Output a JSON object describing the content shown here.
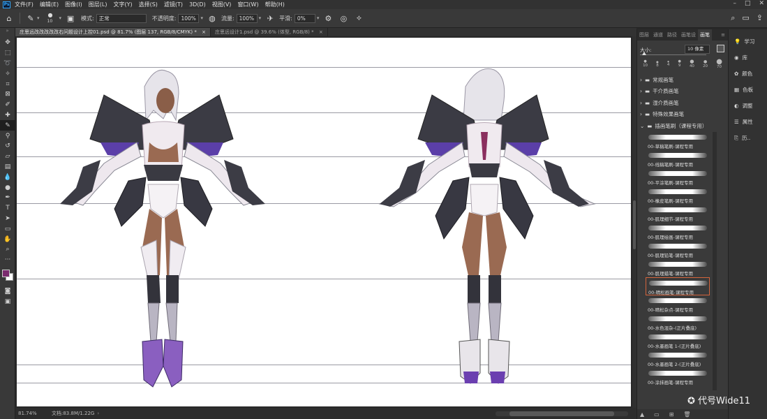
{
  "menubar": {
    "items": [
      "文件(F)",
      "编辑(E)",
      "图像(I)",
      "图层(L)",
      "文字(Y)",
      "选择(S)",
      "滤镜(T)",
      "3D(D)",
      "视图(V)",
      "窗口(W)",
      "帮助(H)"
    ]
  },
  "options": {
    "brush_size": "10",
    "mode_label": "模式:",
    "mode_value": "正常",
    "opacity_label": "不透明度:",
    "opacity_value": "100%",
    "flow_label": "流量:",
    "flow_value": "100%",
    "smooth_label": "平滑:",
    "smooth_value": "0%"
  },
  "tabs": [
    {
      "label": "庄思远改改改改改右问题设计上控01.psd @ 81.7% (图层 137, RGB/8/CMYK) *"
    },
    {
      "label": "庄思远设计1.psd @ 39.6% (体型, RGB/8) *"
    }
  ],
  "status": {
    "zoom": "81.74%",
    "doc": "文档:83.8M/1.22G"
  },
  "panel": {
    "tabs": [
      "图层",
      "通道",
      "路径",
      "画笔设",
      "画笔"
    ],
    "size_label": "大小:",
    "size_value": "10 像素",
    "preset_sizes": [
      "10",
      "8",
      "4",
      "9",
      "40",
      "20",
      "70"
    ],
    "folders": [
      "常规画笔",
      "干介质画笔",
      "湿介质画笔",
      "特殊效果画笔",
      "插画笔刷（课程专用）"
    ],
    "brushes": [
      "00-草稿笔刷-课程专用",
      "00-线稿笔刷-课程专用",
      "00-平涂笔刷-课程专用",
      "00-橡皮笔刷-课程专用",
      "00-肌理细节-课程专用",
      "00-肌理绘画-课程专用",
      "00-肌理铅笔-课程专用",
      "00-肌理蜡笔-课程专用",
      "00-晴松画笔-课程专用",
      "00-晴松杂点-课程专用",
      "00-水色混杂-(正片叠底)",
      "00-水墨画笔 1-(正片叠底)",
      "00-水墨画笔 2-(正片叠底)",
      "00-涂抹画笔-课程专用"
    ],
    "selected_brush_index": 8
  },
  "dock": {
    "items": [
      "学习",
      "库",
      "颜色",
      "色板",
      "调整",
      "属性",
      "历.."
    ]
  },
  "watermark": "代号Wide11",
  "colors": {
    "foreground": "#7a2b6e",
    "background": "#ffffff",
    "accent_selection": "#d4643c"
  }
}
